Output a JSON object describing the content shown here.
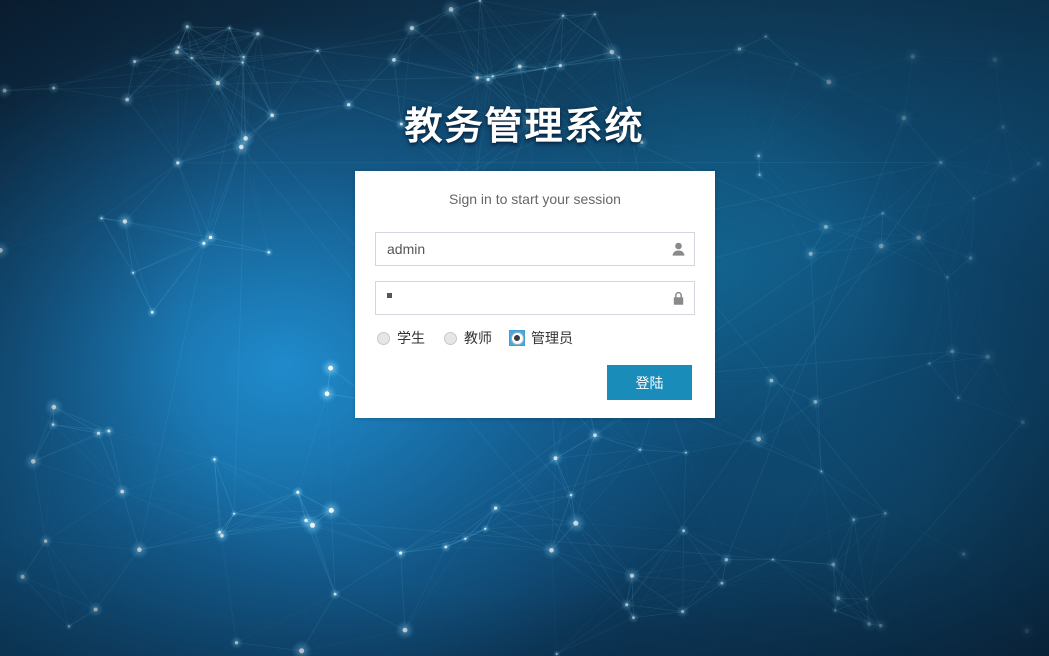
{
  "page": {
    "title": "教务管理系统"
  },
  "card": {
    "message": "Sign in to start your session"
  },
  "form": {
    "username": {
      "value": "admin",
      "placeholder": "",
      "icon": "user-icon"
    },
    "password": {
      "value": "·",
      "masked_length": 1,
      "placeholder": "",
      "icon": "lock-icon"
    },
    "roles": [
      {
        "label": "学生",
        "selected": false
      },
      {
        "label": "教师",
        "selected": false
      },
      {
        "label": "管理员",
        "selected": true
      }
    ],
    "submit_label": "登陆"
  },
  "colors": {
    "button": "#1a8cba",
    "radio_selected_highlight": "#4aa8e0",
    "card_background": "#ffffff",
    "input_border": "#d2d6de",
    "message_text": "#666666",
    "title_text": "#ffffff",
    "background_deep": "#0d2236",
    "background_glow": "#208ed0"
  }
}
